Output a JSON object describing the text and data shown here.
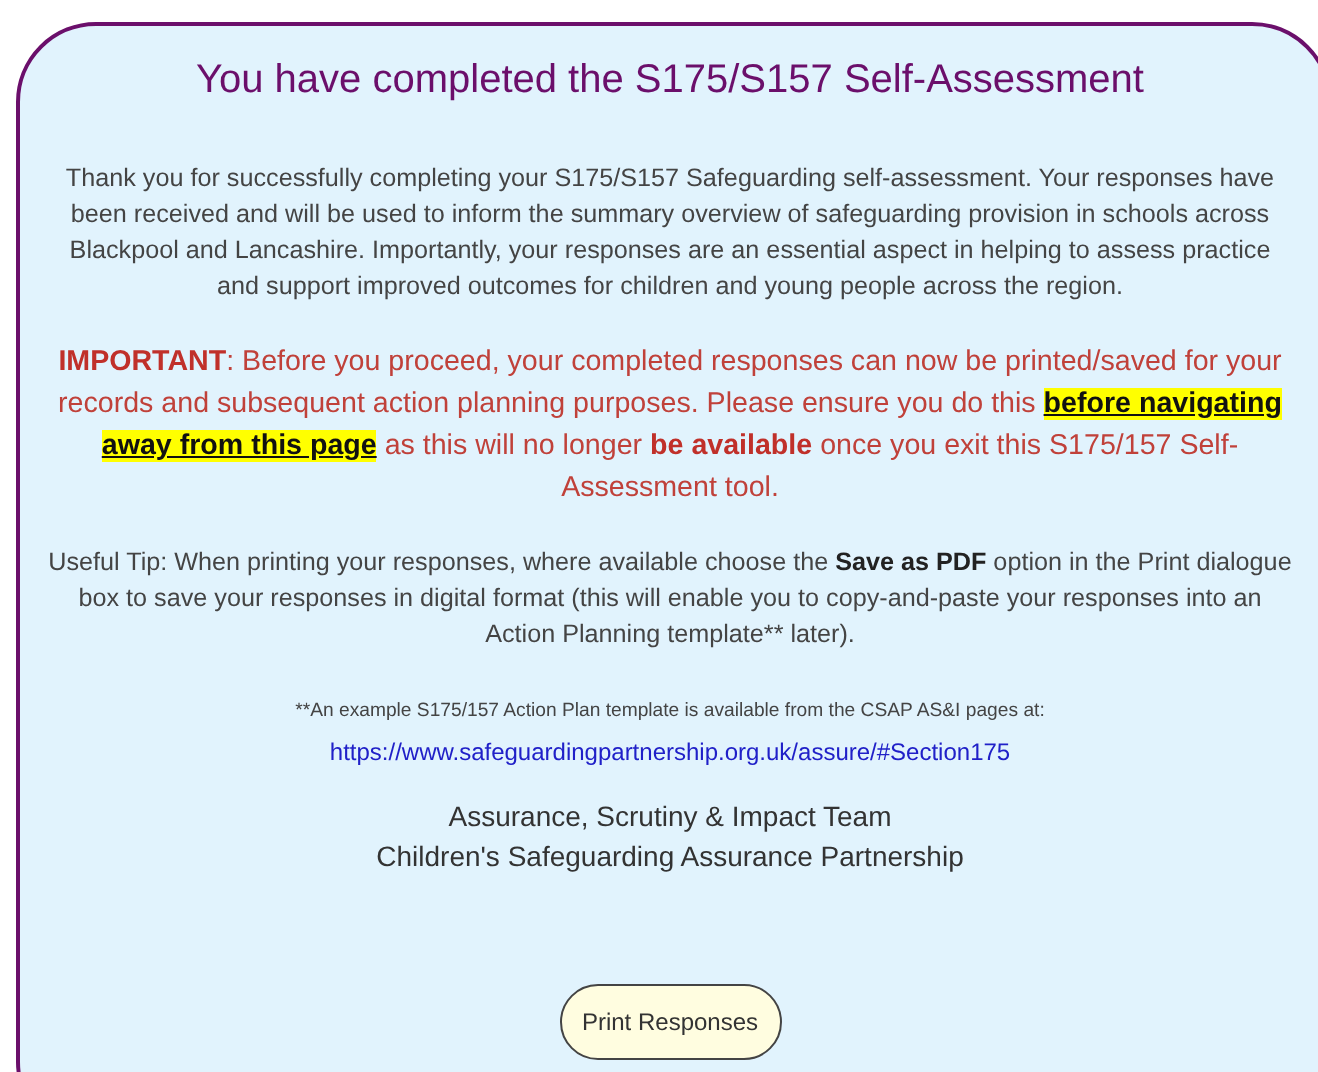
{
  "title": "You have completed the S175/S157 Self-Assessment",
  "intro": "Thank you for successfully completing your S175/S157 Safeguarding self-assessment.  Your responses have been received and will be used to inform the summary overview of safeguarding provision in schools across Blackpool and Lancashire.  Importantly, your responses are an essential aspect in helping to assess practice and support improved outcomes for children and young people across the region.",
  "important": [
    {
      "kind": "plain",
      "text": "**IMPORTANT**: Before you proceed, your completed responses can now be printed/saved for your records and subsequent action planning purposes.  Please ensure you do this "
    },
    {
      "kind": "highlight",
      "text": "before navigating away from this page"
    },
    {
      "kind": "plain",
      "text": " as this will no longer **be available** once you exit this S175/157 Self-Assessment tool."
    }
  ],
  "tip": "Useful Tip: When printing your responses, where available choose the **Save as PDF** option in the Print dialogue box to save your responses in digital format (this will enable you to copy-and-paste your responses into an Action Planning template** later).",
  "footnote": "**An example S175/157 Action Plan template is available from the CSAP AS&I pages at:",
  "link": "https://www.safeguardingpartnership.org.uk/assure/#Section175",
  "signature": [
    "Assurance, Scrutiny & Impact Team",
    "Children's Safeguarding Assurance Partnership"
  ],
  "button": "Print Responses"
}
